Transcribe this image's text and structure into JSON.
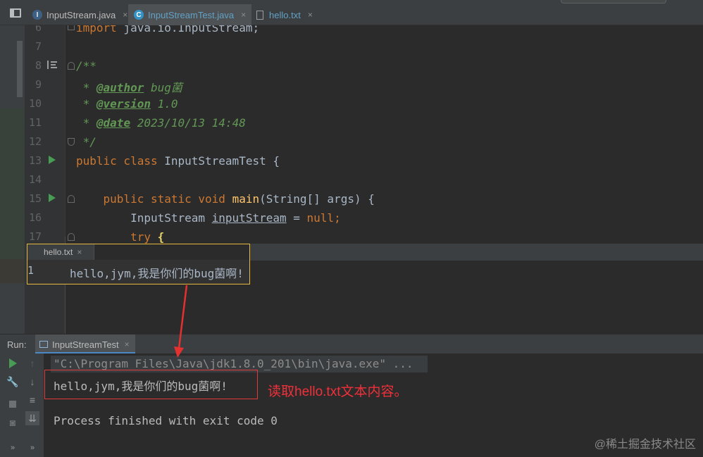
{
  "tabs": [
    {
      "label": "InputStream.java",
      "icon": "I",
      "active": false
    },
    {
      "label": "InputStreamTest.java",
      "icon": "C",
      "active": true
    },
    {
      "label": "hello.txt",
      "icon": "file",
      "active": false
    }
  ],
  "tab_close": "×",
  "editor": {
    "line_numbers": [
      "6",
      "7",
      "8",
      "9",
      "10",
      "11",
      "12",
      "13",
      "14",
      "15",
      "16",
      "17"
    ],
    "import_kw": "import",
    "import_rest": " java.io.InputStream;",
    "doc_open": "/**",
    "doc_star": " * ",
    "author_tag": "@author",
    "author_val": " bug菌",
    "version_tag": "@version",
    "version_val": " 1.0",
    "date_tag": "@date",
    "date_val": " 2023/10/13 14:48",
    "doc_close": " */",
    "class_kw": "public class",
    "class_name": " InputStreamTest {",
    "main_kw": "public static void",
    "main_fn": "main",
    "main_rest": "(String[] args) {",
    "stream_type": "InputStream ",
    "stream_var": "inputStream",
    "stream_eq": " = ",
    "stream_null": "null",
    "stream_semi": ";",
    "try_kw": "try",
    "try_brace": "{"
  },
  "popup": {
    "tab": "hello.txt",
    "close": "×",
    "line_number": "1",
    "content": "hello,jym,我是你们的bug菌啊!"
  },
  "run": {
    "label": "Run:",
    "tab": "InputStreamTest",
    "close": "×",
    "command": "\"C:\\Program Files\\Java\\jdk1.8.0_201\\bin\\java.exe\" ...",
    "output": "hello,jym,我是你们的bug菌啊!",
    "finished": "Process finished with exit code 0"
  },
  "annotation": "读取hello.txt文本内容。",
  "watermark": "@稀土掘金技术社区",
  "colors": {
    "keyword": "#cc7832",
    "doc": "#629755",
    "annotation": "#f0303a",
    "popup_border": "#e6b93d"
  }
}
